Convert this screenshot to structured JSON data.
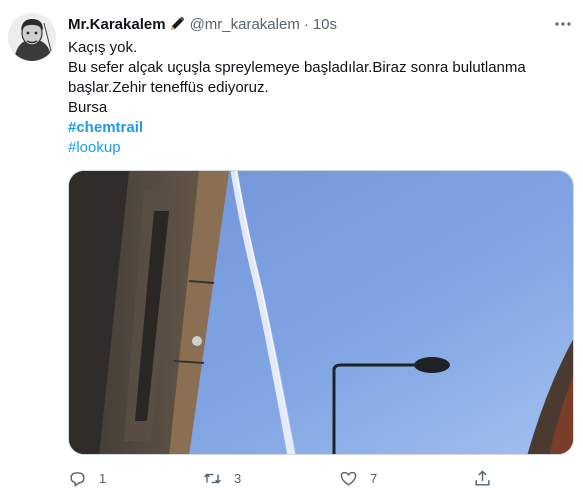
{
  "tweet": {
    "display_name": "Mr.Karakalem",
    "verified_icon": "pen-icon",
    "handle": "@mr_karakalem",
    "separator": "·",
    "time": "10s",
    "lines": [
      "Kaçış yok.",
      "Bu sefer alçak uçuşla spreylemeye başladılar.Biraz sonra bulutlanma",
      "başlar.Zehir teneffüs ediyoruz.",
      "Bursa"
    ],
    "hashtags": [
      "#chemtrail",
      "#lookup"
    ],
    "media": {
      "description_icon": "photo-sky-contrail",
      "sky_color": "#7096d9"
    }
  },
  "actions": {
    "reply": {
      "icon": "reply-icon",
      "count": "1"
    },
    "retweet": {
      "icon": "retweet-icon",
      "count": "3"
    },
    "like": {
      "icon": "heart-icon",
      "count": "7"
    },
    "share": {
      "icon": "share-icon",
      "count": ""
    }
  },
  "colors": {
    "text": "#0f1419",
    "secondary": "#536471",
    "link": "#1d9bf0",
    "border": "#cfd9de"
  }
}
